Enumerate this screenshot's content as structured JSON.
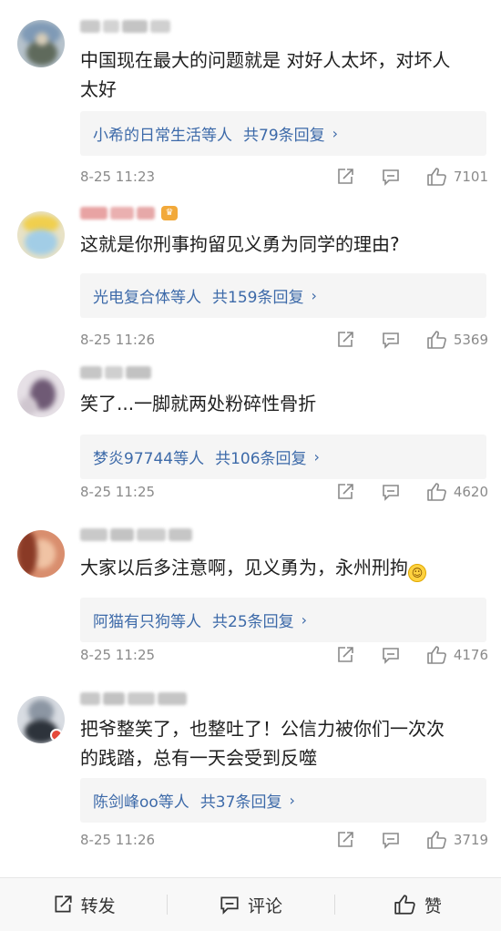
{
  "comments": [
    {
      "content": "中国现在最大的问题就是 对好人太坏，对坏人太好",
      "reply_summary": "小希的日常生活等人",
      "reply_count": "共79条回复",
      "time": "8-25 11:23",
      "likes": "7101",
      "avatar_colors": [
        "#8aa0b8",
        "#c9c2b2",
        "#6f7b6a"
      ]
    },
    {
      "content": "这就是你刑事拘留见义勇为同学的理由?",
      "reply_summary": "光电复合体等人",
      "reply_count": "共159条回复",
      "time": "8-25 11:26",
      "likes": "5369",
      "avatar_colors": [
        "#f3d35a",
        "#9ccbe6",
        "#e8e2c6"
      ]
    },
    {
      "content": "笑了...一脚就两处粉碎性骨折",
      "reply_summary": "梦炎97744等人",
      "reply_count": "共106条回复",
      "time": "8-25 11:25",
      "likes": "4620",
      "avatar_colors": [
        "#cfc6cf",
        "#6e5a73",
        "#e9e3ea"
      ]
    },
    {
      "content": "大家以后多注意啊，见义勇为，永州刑拘",
      "emoji": "grin-sweat-emoji",
      "reply_summary": "阿猫有只狗等人",
      "reply_count": "共25条回复",
      "time": "8-25 11:25",
      "likes": "4176",
      "avatar_colors": [
        "#b4593e",
        "#e7b08f",
        "#5a2c22"
      ]
    },
    {
      "content": "把爷整笑了，也整吐了！公信力被你们一次次的践踏，总有一天会受到反噬",
      "reply_summary": "陈剑峰oo等人",
      "reply_count": "共37条回复",
      "time": "8-25 11:26",
      "likes": "3719",
      "avatar_colors": [
        "#5f6a78",
        "#d8dce2",
        "#2d333b"
      ]
    }
  ],
  "bottom_bar": {
    "repost": "转发",
    "comment": "评论",
    "like": "赞"
  },
  "icons": {
    "repost": "share-icon",
    "reply": "comment-icon",
    "like": "thumbs-up-icon",
    "chevron": "chevron-right-icon"
  },
  "colors": {
    "link": "#3d6aa9",
    "meta": "#8a8a8a",
    "reply_bg": "#f5f5f5"
  }
}
